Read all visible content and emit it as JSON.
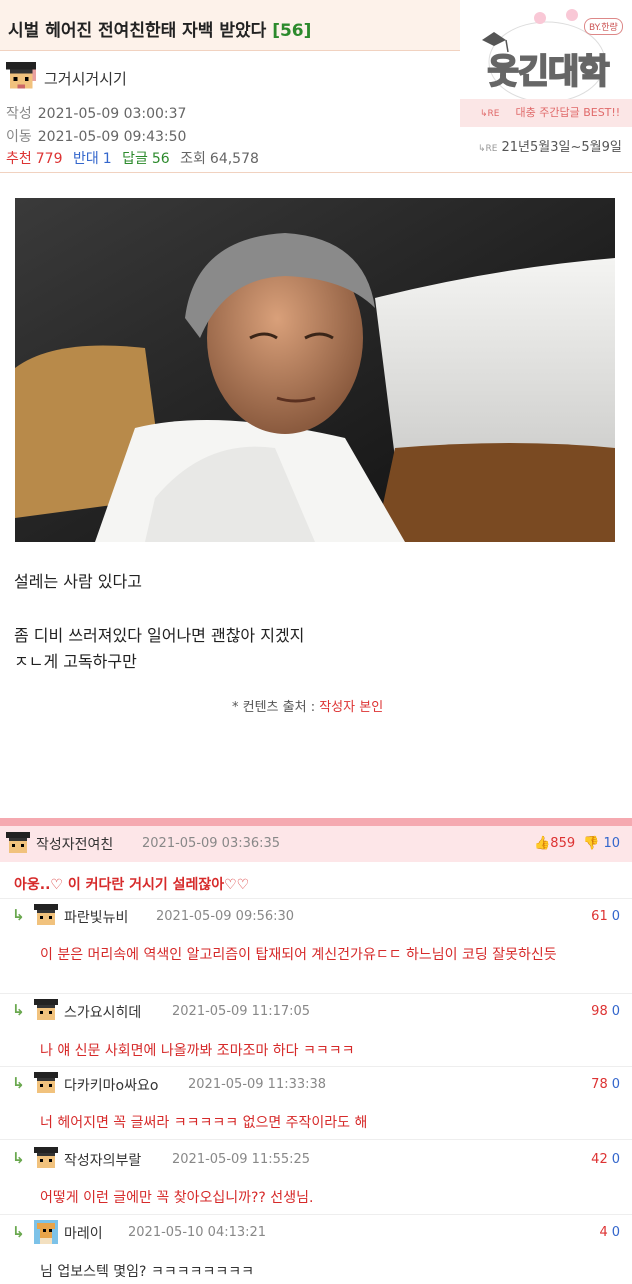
{
  "post": {
    "title": "시벌 헤어진 전여친한태 자백 받았다",
    "comment_count": "[56]",
    "author": "그거시거시기",
    "created_label": "작성",
    "created": "2021-05-09 03:00:37",
    "moved_label": "이동",
    "moved": "2021-05-09 09:43:50",
    "stats": {
      "rec_label": "추천",
      "rec": "779",
      "opp_label": "반대",
      "opp": "1",
      "rep_label": "답글",
      "rep": "56",
      "view_label": "조회",
      "view": "64,578"
    },
    "body_lines": [
      "설레는 사람 있다고",
      "좀 디비 쓰러져있다 일어나면 괜찮아 지겠지",
      "ㅈㄴ게 고독하구만"
    ],
    "source_label": "* 컨텐츠 출처 :",
    "source_value": "작성자 본인"
  },
  "logo": {
    "text": "웃긴대학",
    "badge": "BY.한량",
    "re": "↳RE",
    "best": "대충 주간답글 BEST!!",
    "week": "21년5월3일~5월9일"
  },
  "comments": [
    {
      "name": "작성자전여친",
      "date": "2021-05-09 03:36:35",
      "text": "아웅..♡ 이 커다란 거시기 설레잖아♡♡",
      "up": "859",
      "down": "10"
    },
    {
      "name": "파란빛뉴비",
      "date": "2021-05-09 09:56:30",
      "text": "이 분은 머리속에 역색인 알고리즘이 탑재되어 계신건가유ㄷㄷ 하느님이 코딩 잘못하신듯",
      "up": "61",
      "down": "0"
    },
    {
      "name": "스가요시히데",
      "date": "2021-05-09 11:17:05",
      "text": "나 얘 신문 사회면에 나올까봐 조마조마 하다 ㅋㅋㅋㅋ",
      "up": "98",
      "down": "0"
    },
    {
      "name": "다카키마o싸요o",
      "date": "2021-05-09 11:33:38",
      "text": "너 헤어지면 꼭 글써라 ㅋㅋㅋㅋㅋ 없으면 주작이라도 해",
      "up": "78",
      "down": "0"
    },
    {
      "name": "작성자의부랄",
      "date": "2021-05-09 11:55:25",
      "text": "어떻게 이런 글에만 꼭 찾아오십니까?? 선생님.",
      "up": "42",
      "down": "0"
    },
    {
      "name": "마레이",
      "date": "2021-05-10 04:13:21",
      "text": "님 업보스텍 몇임? ㅋㅋㅋㅋㅋㅋㅋㅋ",
      "up": "4",
      "down": "0"
    }
  ],
  "reply_icon": "↳"
}
